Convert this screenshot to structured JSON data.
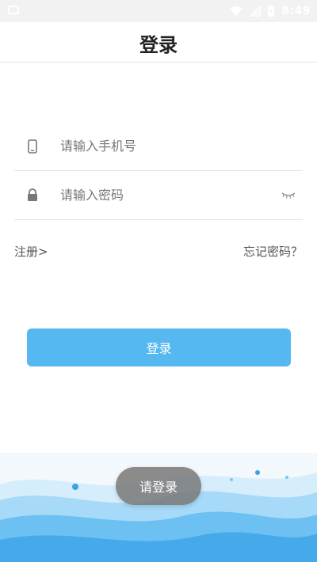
{
  "status_bar": {
    "time": "8:49",
    "icons": [
      "picture-icon",
      "wifi-icon",
      "no-signal-icon",
      "battery-charging-icon"
    ]
  },
  "header": {
    "title": "登录"
  },
  "form": {
    "phone": {
      "icon": "phone-icon",
      "placeholder": "请输入手机号",
      "value": ""
    },
    "password": {
      "icon": "lock-icon",
      "placeholder": "请输入密码",
      "value": "",
      "toggle_icon": "eye-closed-icon"
    },
    "register_link": "注册>",
    "forgot_link": "忘记密码？",
    "login_button": "登录"
  },
  "toast": {
    "message": "请登录"
  },
  "colors": {
    "accent": "#56b8f0",
    "wave_light": "#bfe3fb",
    "wave_mid": "#86cbf4",
    "wave_dark": "#4aa9ea"
  }
}
